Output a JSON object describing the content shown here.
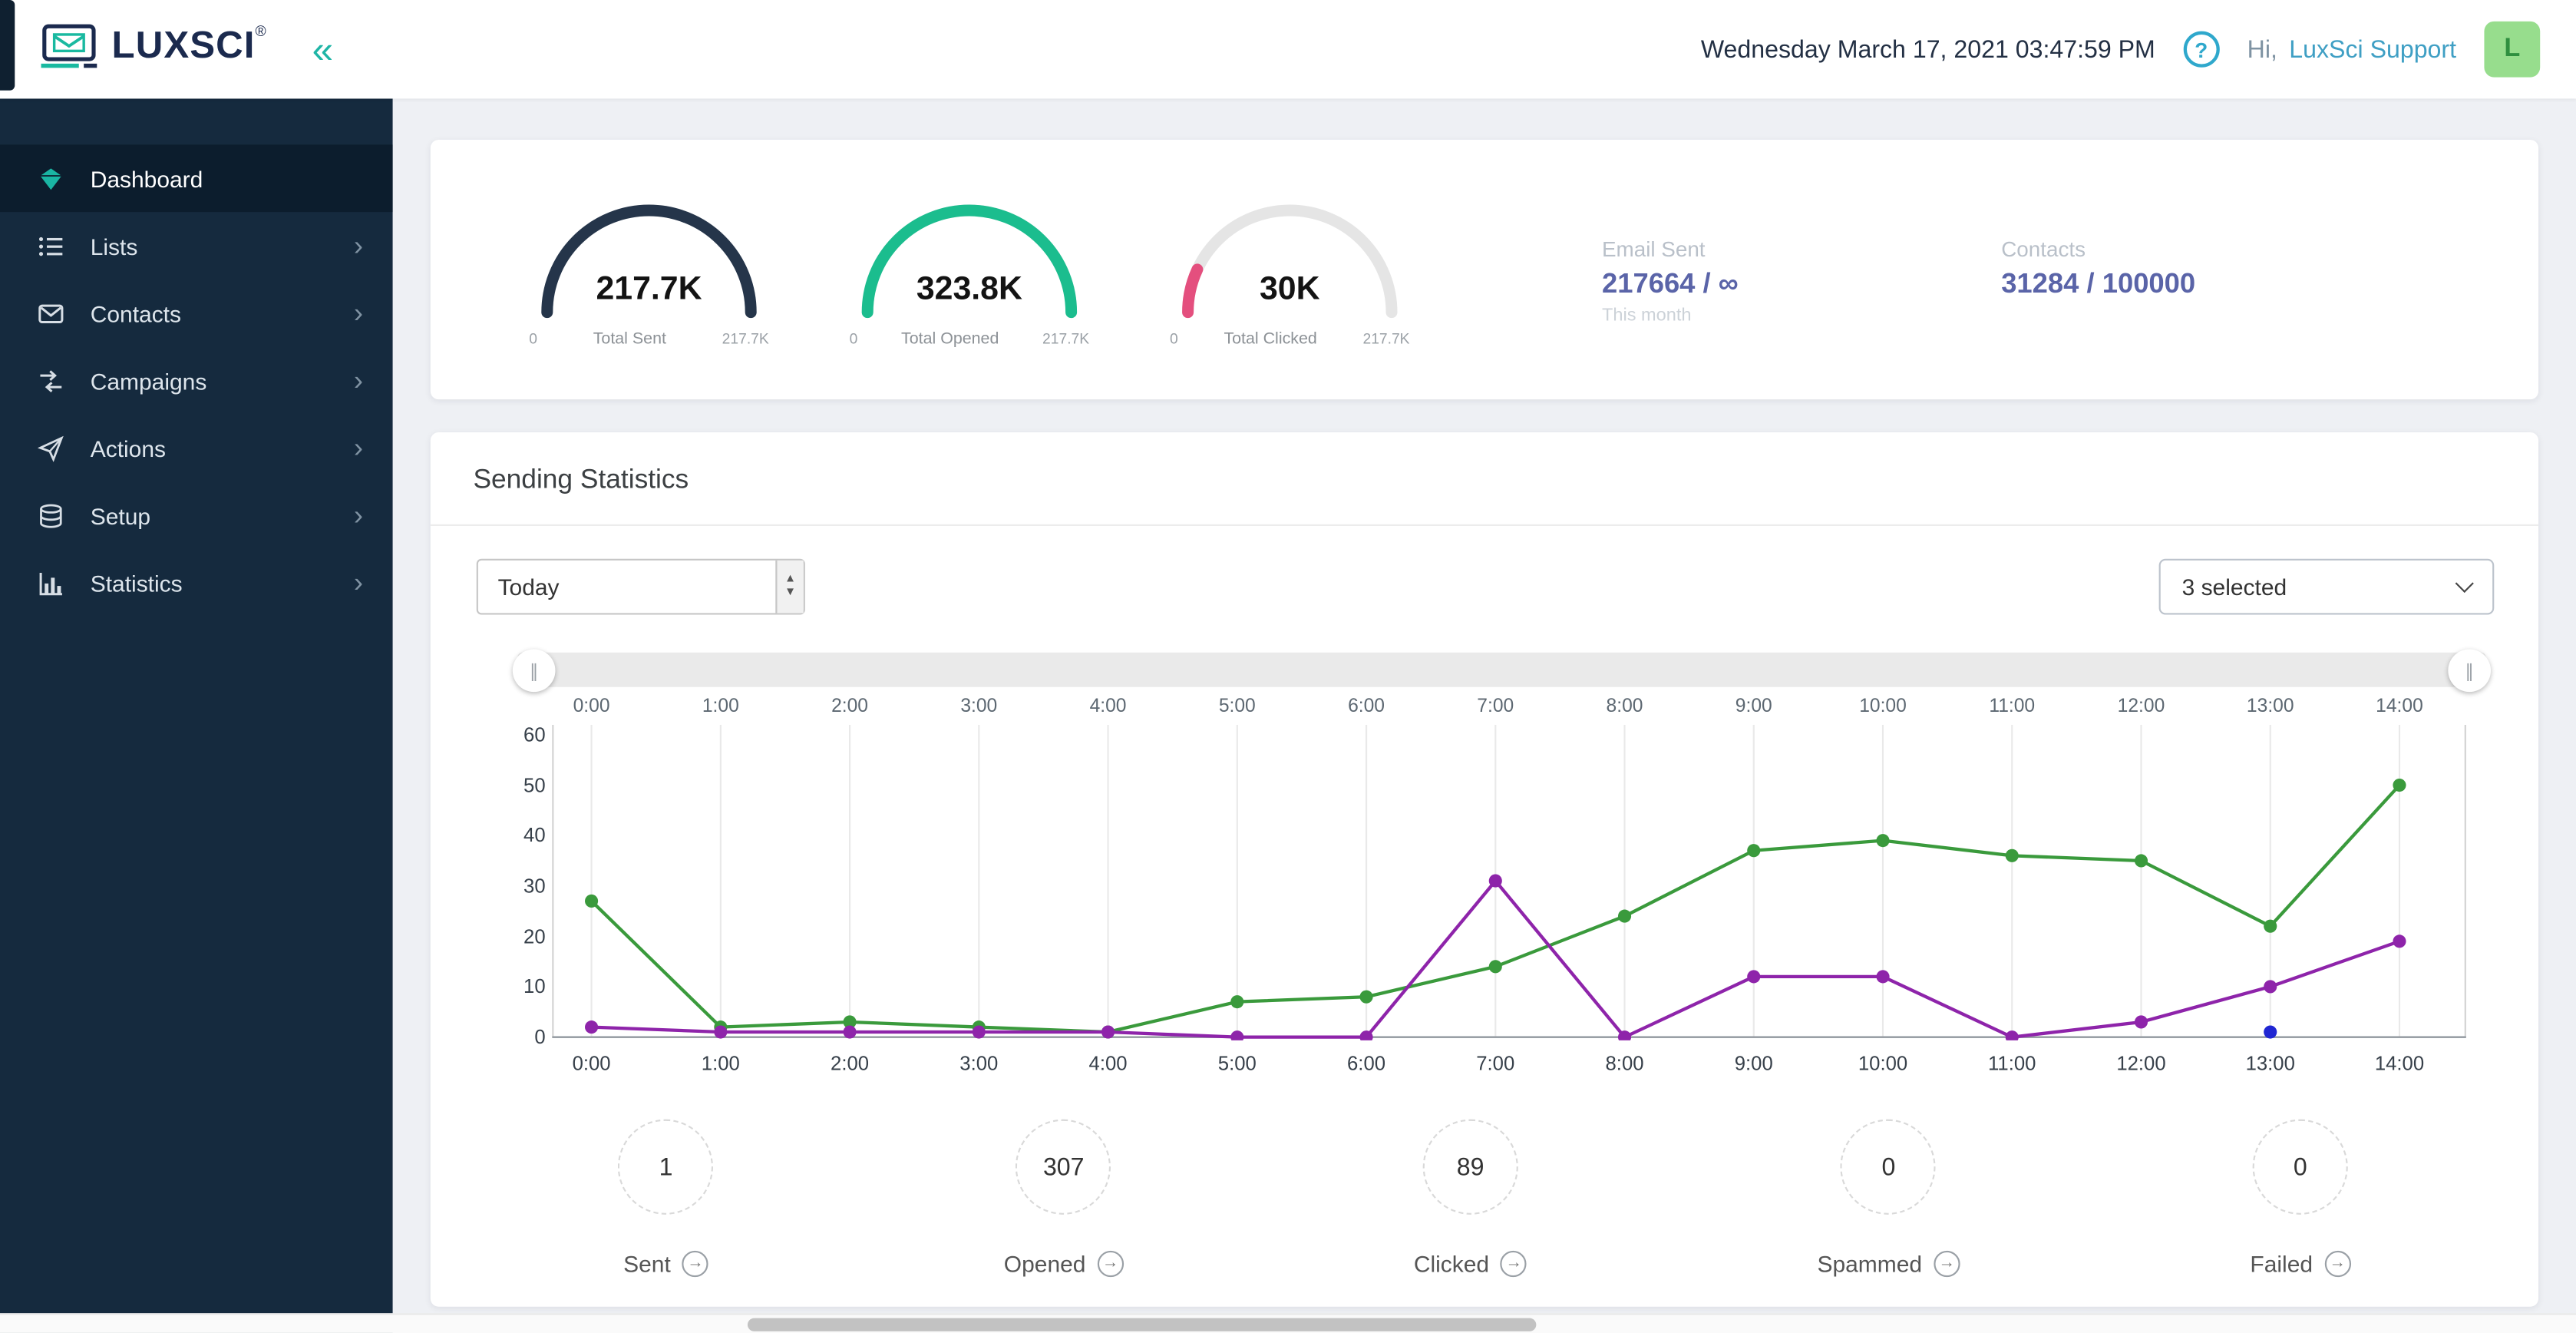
{
  "icons": {
    "collapse": "«",
    "help": "?",
    "chevron_right": "›",
    "scrub_handle": "∥",
    "arrow_right": "→",
    "spinner_up": "▲",
    "spinner_down": "▼"
  },
  "header": {
    "brand": "LUXSCI",
    "brand_reg": "®",
    "datetime": "Wednesday March 17, 2021 03:47:59 PM",
    "greeting_prefix": "Hi,",
    "user_name": "LuxSci Support",
    "avatar_letter": "L"
  },
  "sidebar": {
    "items": [
      {
        "label": "Dashboard",
        "active": true
      },
      {
        "label": "Lists"
      },
      {
        "label": "Contacts"
      },
      {
        "label": "Campaigns"
      },
      {
        "label": "Actions"
      },
      {
        "label": "Setup"
      },
      {
        "label": "Statistics"
      }
    ]
  },
  "summary": {
    "gauges": [
      {
        "value": "217.7K",
        "label": "Total Sent",
        "min": "0",
        "max": "217.7K",
        "color": "#25354a",
        "fraction": 1
      },
      {
        "value": "323.8K",
        "label": "Total Opened",
        "min": "0",
        "max": "217.7K",
        "color": "#1bbd8e",
        "fraction": 1
      },
      {
        "value": "30K",
        "label": "Total Clicked",
        "min": "0",
        "max": "217.7K",
        "color": "#e44f7e",
        "fraction": 0.138
      }
    ],
    "email_sent": {
      "label": "Email Sent",
      "value": "217664 / ∞",
      "sub": "This month"
    },
    "contacts": {
      "label": "Contacts",
      "value": "31284 / 100000"
    }
  },
  "stats_card": {
    "title": "Sending Statistics",
    "range_select_value": "Today",
    "series_select_value": "3 selected",
    "counters": [
      {
        "value": "1",
        "label": "Sent"
      },
      {
        "value": "307",
        "label": "Opened"
      },
      {
        "value": "89",
        "label": "Clicked"
      },
      {
        "value": "0",
        "label": "Spammed"
      },
      {
        "value": "0",
        "label": "Failed"
      }
    ]
  },
  "chart_data": {
    "type": "line",
    "title": "Sending Statistics",
    "x": [
      "0:00",
      "1:00",
      "2:00",
      "3:00",
      "4:00",
      "5:00",
      "6:00",
      "7:00",
      "8:00",
      "9:00",
      "10:00",
      "11:00",
      "12:00",
      "13:00",
      "14:00"
    ],
    "series": [
      {
        "name": "Opened",
        "color": "#3a9a3c",
        "values": [
          27,
          2,
          3,
          2,
          1,
          7,
          8,
          14,
          24,
          37,
          39,
          36,
          35,
          22,
          50
        ]
      },
      {
        "name": "Clicked",
        "color": "#8e24aa",
        "values": [
          2,
          1,
          1,
          1,
          1,
          0,
          0,
          31,
          0,
          12,
          12,
          0,
          3,
          10,
          19
        ]
      },
      {
        "name": "Sent",
        "color": "#2026d2",
        "values": [
          null,
          null,
          null,
          null,
          null,
          null,
          null,
          null,
          null,
          null,
          null,
          null,
          null,
          1,
          null
        ]
      }
    ],
    "ylim": [
      0,
      60
    ],
    "yticks": [
      0,
      10,
      20,
      30,
      40,
      50,
      60
    ],
    "grid": "vertical",
    "legend_position": "hidden"
  }
}
